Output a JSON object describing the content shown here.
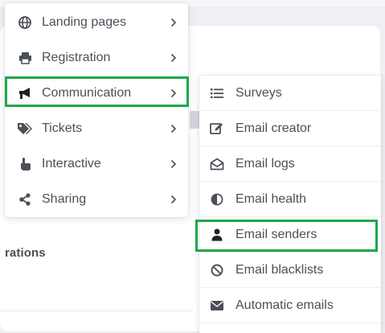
{
  "main_menu": {
    "items": [
      {
        "label": "Landing pages",
        "icon": "globe-icon"
      },
      {
        "label": "Registration",
        "icon": "printer-icon"
      },
      {
        "label": "Communication",
        "icon": "megaphone-icon",
        "highlighted": true
      },
      {
        "label": "Tickets",
        "icon": "tags-icon"
      },
      {
        "label": "Interactive",
        "icon": "hand-pointer-icon"
      },
      {
        "label": "Sharing",
        "icon": "share-icon"
      }
    ]
  },
  "sub_menu": {
    "items": [
      {
        "label": "Surveys",
        "icon": "list-icon"
      },
      {
        "label": "Email creator",
        "icon": "edit-icon"
      },
      {
        "label": "Email logs",
        "icon": "envelope-open-icon"
      },
      {
        "label": "Email health",
        "icon": "adjust-icon"
      },
      {
        "label": "Email senders",
        "icon": "user-icon",
        "highlighted": true
      },
      {
        "label": "Email blacklists",
        "icon": "ban-icon"
      },
      {
        "label": "Automatic emails",
        "icon": "envelope-icon"
      }
    ]
  },
  "background": {
    "section_text": "rations"
  },
  "colors": {
    "highlight": "#1ea84b",
    "text": "#4b5058",
    "icon": "#4b5058"
  }
}
